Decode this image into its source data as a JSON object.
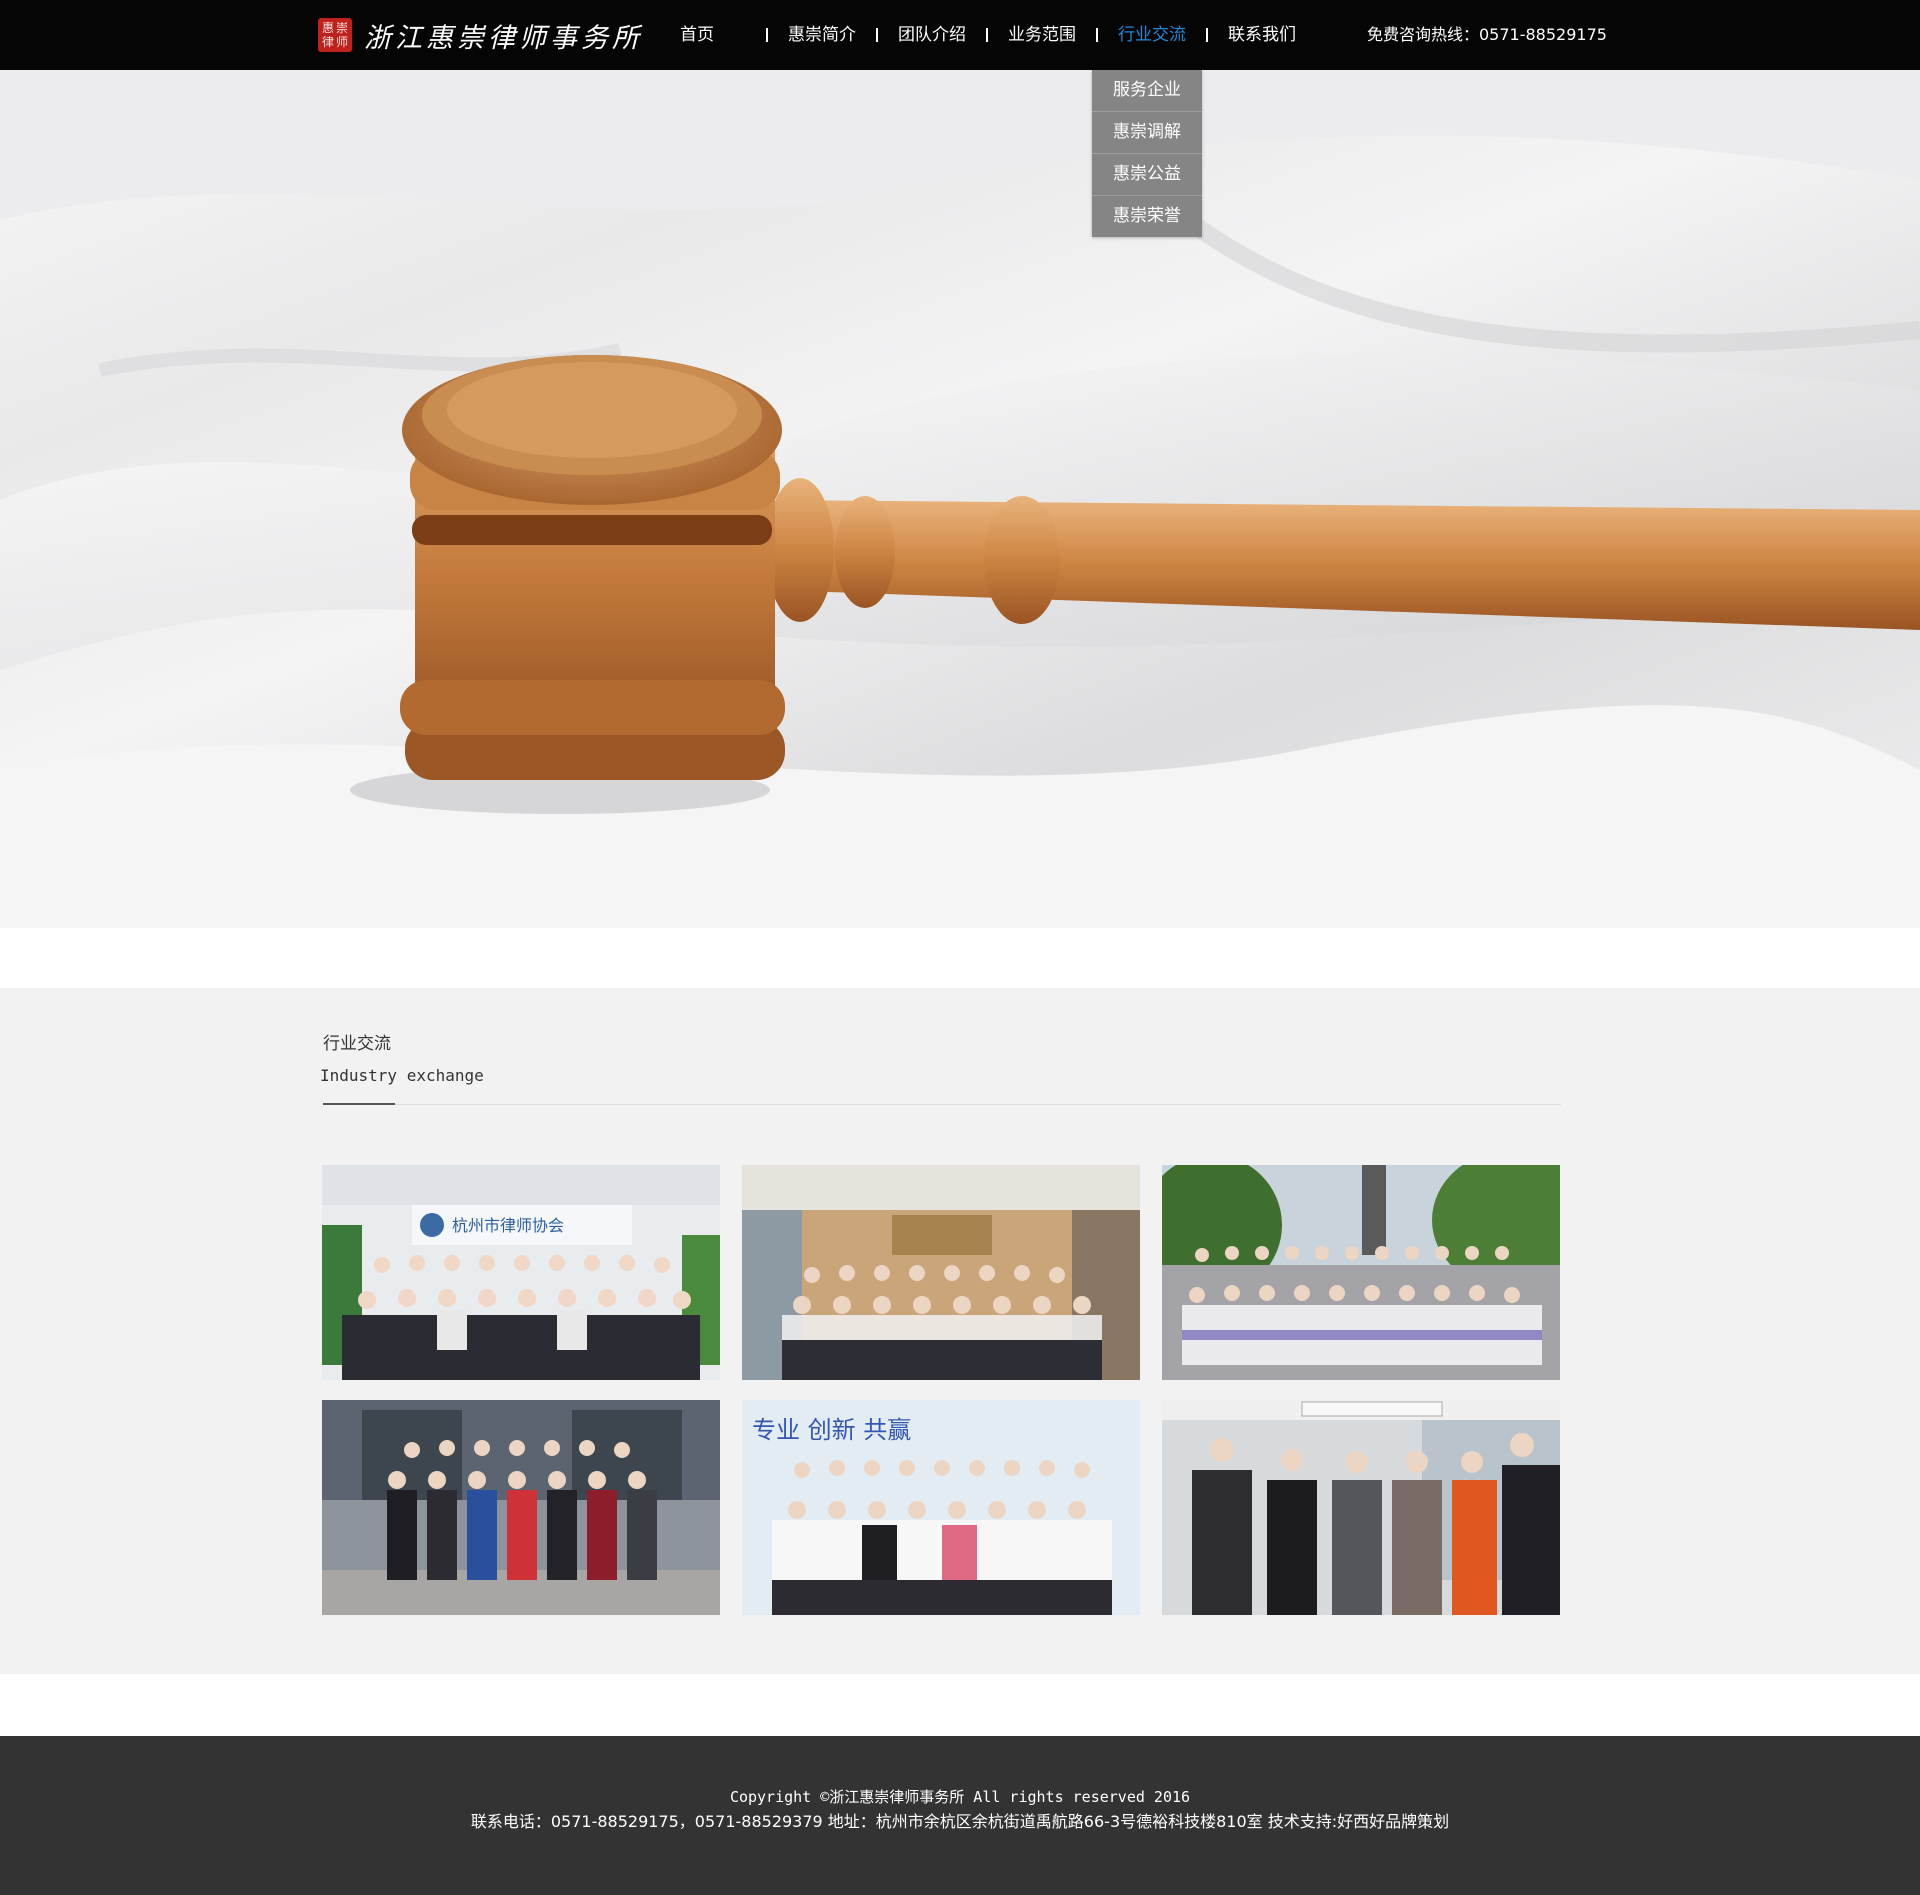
{
  "header": {
    "logo_text": "浙江惠崇律师事务所",
    "logo_seal_chars": [
      "惠",
      "崇",
      "律",
      "师"
    ],
    "nav": [
      {
        "label": "首页",
        "active": false
      },
      {
        "label": "惠崇简介",
        "active": false
      },
      {
        "label": "团队介绍",
        "active": false
      },
      {
        "label": "业务范围",
        "active": false
      },
      {
        "label": "行业交流",
        "active": true
      },
      {
        "label": "联系我们",
        "active": false
      }
    ],
    "hotline": "免费咨询热线：0571-88529175"
  },
  "dropdown": {
    "items": [
      "服务企业",
      "惠崇调解",
      "惠崇公益",
      "惠崇荣誉"
    ]
  },
  "hero": {
    "subject": "wooden judge gavel on white cloth"
  },
  "section": {
    "title": "行业交流",
    "subtitle": "Industry exchange",
    "photos": [
      {
        "theme": "group-photo-lawyers-association",
        "sign_text": "杭州市律师协会"
      },
      {
        "theme": "group-photo-meeting-room"
      },
      {
        "theme": "group-photo-outdoor-trees"
      },
      {
        "theme": "group-photo-building-entrance"
      },
      {
        "theme": "group-photo-office-banner",
        "banner_text": "专业  创新  共赢"
      },
      {
        "theme": "group-photo-office-lobby"
      }
    ]
  },
  "footer": {
    "copyright": "Copyright ©浙江惠崇律师事务所 All rights reserved 2016",
    "contact": "联系电话：0571-88529175，0571-88529379 地址：杭州市余杭区余杭街道禹航路66-3号德裕科技楼810室 技术支持:好西好品牌策划"
  },
  "colors": {
    "topbar": "#050505",
    "nav_active": "#1f8ad9",
    "dropdown_bg": "#858585",
    "content_bg": "#f2f2f2",
    "footer_bg": "#333333"
  }
}
